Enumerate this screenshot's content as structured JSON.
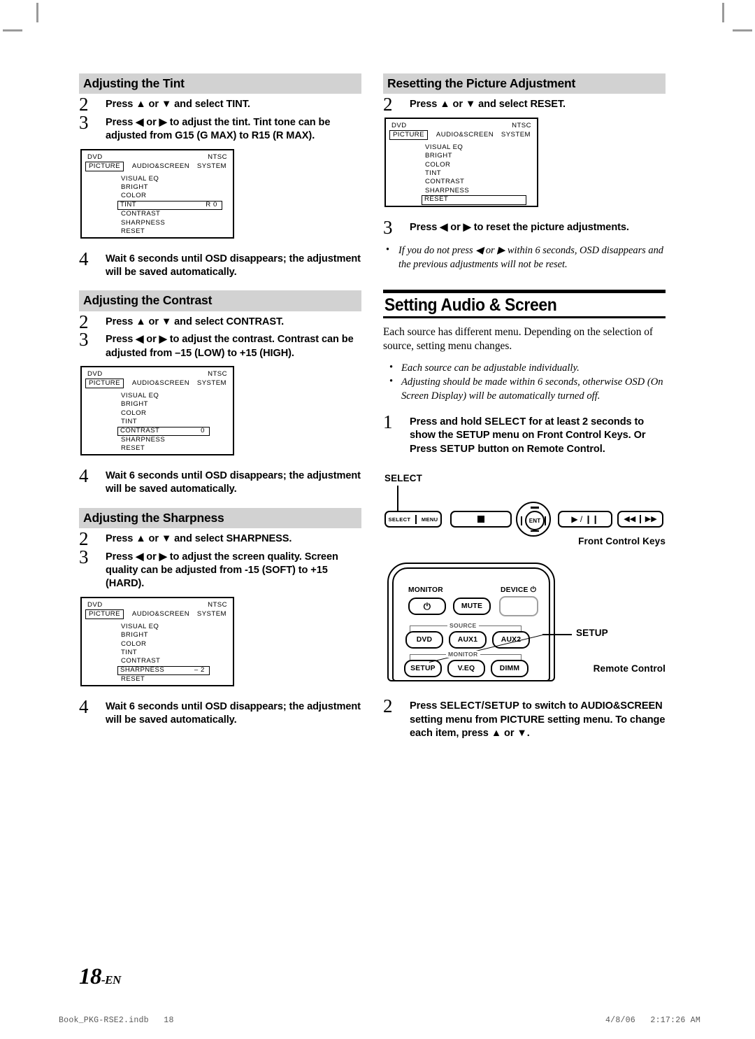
{
  "page": {
    "number_display": "18",
    "number_suffix": "-EN",
    "footer_file": "Book_PKG-RSE2.indb   18",
    "footer_timestamp": "4/8/06   2:17:26 AM"
  },
  "left_column": {
    "sections": [
      {
        "heading": "Adjusting the Tint",
        "steps": [
          {
            "num": "2",
            "text": "Press ▲ or ▼ and select TINT."
          },
          {
            "num": "3",
            "text": "Press ◀ or ▶ to adjust the tint. Tint tone can be adjusted from G15 (G MAX) to R15 (R MAX)."
          }
        ],
        "osd": {
          "source": "DVD",
          "standard": "NTSC",
          "tab_selected": "PICTURE",
          "tab_middle": "AUDIO&SCREEN",
          "tab_right": "SYSTEM",
          "items": [
            {
              "label": "VISUAL EQ",
              "value": "",
              "selected": false
            },
            {
              "label": "BRIGHT",
              "value": "",
              "selected": false
            },
            {
              "label": "COLOR",
              "value": "",
              "selected": false
            },
            {
              "label": "TINT",
              "value": "R   0",
              "selected": true
            },
            {
              "label": "CONTRAST",
              "value": "",
              "selected": false
            },
            {
              "label": "SHARPNESS",
              "value": "",
              "selected": false
            },
            {
              "label": "RESET",
              "value": "",
              "selected": false
            }
          ]
        },
        "after_step": {
          "num": "4",
          "text": "Wait 6 seconds until OSD disappears; the adjustment will be saved automatically."
        }
      },
      {
        "heading": "Adjusting the Contrast",
        "steps": [
          {
            "num": "2",
            "text": "Press ▲ or ▼ and select CONTRAST."
          },
          {
            "num": "3",
            "text": "Press ◀ or ▶ to adjust the contrast. Contrast can be adjusted from –15 (LOW) to +15 (HIGH)."
          }
        ],
        "osd": {
          "source": "DVD",
          "standard": "NTSC",
          "tab_selected": "PICTURE",
          "tab_middle": "AUDIO&SCREEN",
          "tab_right": "SYSTEM",
          "items": [
            {
              "label": "VISUAL EQ",
              "value": "",
              "selected": false
            },
            {
              "label": "BRIGHT",
              "value": "",
              "selected": false
            },
            {
              "label": "COLOR",
              "value": "",
              "selected": false
            },
            {
              "label": "TINT",
              "value": "",
              "selected": false
            },
            {
              "label": "CONTRAST",
              "value": "0",
              "selected": true
            },
            {
              "label": "SHARPNESS",
              "value": "",
              "selected": false
            },
            {
              "label": "RESET",
              "value": "",
              "selected": false
            }
          ]
        },
        "after_step": {
          "num": "4",
          "text": "Wait 6 seconds until OSD disappears; the adjustment will be saved automatically."
        }
      },
      {
        "heading": "Adjusting the Sharpness",
        "steps": [
          {
            "num": "2",
            "text": "Press ▲ or ▼ and select SHARPNESS."
          },
          {
            "num": "3",
            "text": "Press ◀ or ▶ to adjust the screen quality. Screen quality can be adjusted from -15 (SOFT) to +15 (HARD)."
          }
        ],
        "osd": {
          "source": "DVD",
          "standard": "NTSC",
          "tab_selected": "PICTURE",
          "tab_middle": "AUDIO&SCREEN",
          "tab_right": "SYSTEM",
          "items": [
            {
              "label": "VISUAL EQ",
              "value": "",
              "selected": false
            },
            {
              "label": "BRIGHT",
              "value": "",
              "selected": false
            },
            {
              "label": "COLOR",
              "value": "",
              "selected": false
            },
            {
              "label": "TINT",
              "value": "",
              "selected": false
            },
            {
              "label": "CONTRAST",
              "value": "",
              "selected": false
            },
            {
              "label": "SHARPNESS",
              "value": "– 2",
              "selected": true
            },
            {
              "label": "RESET",
              "value": "",
              "selected": false
            }
          ]
        },
        "after_step": {
          "num": "4",
          "text": "Wait 6 seconds until OSD disappears; the adjustment will be saved automatically."
        }
      }
    ]
  },
  "right_column": {
    "reset_section": {
      "heading": "Resetting the Picture Adjustment",
      "step2": {
        "num": "2",
        "text": "Press ▲ or ▼ and select RESET."
      },
      "osd": {
        "source": "DVD",
        "standard": "NTSC",
        "tab_selected": "PICTURE",
        "tab_middle": "AUDIO&SCREEN",
        "tab_right": "SYSTEM",
        "items": [
          {
            "label": "VISUAL EQ",
            "value": "",
            "selected": false
          },
          {
            "label": "BRIGHT",
            "value": "",
            "selected": false
          },
          {
            "label": "COLOR",
            "value": "",
            "selected": false
          },
          {
            "label": "TINT",
            "value": "",
            "selected": false
          },
          {
            "label": "CONTRAST",
            "value": "",
            "selected": false
          },
          {
            "label": "SHARPNESS",
            "value": "",
            "selected": false
          },
          {
            "label": "RESET",
            "value": "",
            "selected": true
          }
        ]
      },
      "step3": {
        "num": "3",
        "text": "Press ◀ or ▶ to reset the picture adjustments."
      },
      "note": "If you do not press ◀ or ▶  within 6 seconds, OSD disappears and the previous adjustments will not be reset."
    },
    "chapter": {
      "title": "Setting Audio & Screen",
      "intro": "Each source has different menu. Depending on the selection of source, setting menu changes.",
      "notes": [
        "Each source can be adjustable individually.",
        "Adjusting should be made within 6 seconds, otherwise OSD (On Screen Display) will be automatically turned off."
      ],
      "step1": {
        "num": "1",
        "segments": [
          {
            "t": "Press and hold ",
            "bold": false
          },
          {
            "t": "SELECT",
            "bold": true
          },
          {
            "t": " for at least 2 seconds to show the SETUP menu on Front Control Keys. Or Press ",
            "bold": false
          },
          {
            "t": "SETUP",
            "bold": true
          },
          {
            "t": " button on Remote Control.",
            "bold": false
          }
        ]
      },
      "step2": {
        "num": "2",
        "segments": [
          {
            "t": "Press ",
            "bold": false
          },
          {
            "t": "SELECT/SETUP",
            "bold": true
          },
          {
            "t": " to switch to AUDIO&SCREEN setting menu from PICTURE setting menu. To change each item, press ▲ or ▼.",
            "bold": false
          }
        ]
      }
    },
    "front_control_keys": {
      "callout_label": "SELECT",
      "caption": "Front Control Keys",
      "keys": [
        {
          "name": "select-menu-key",
          "labels": [
            "SELECT",
            "MENU"
          ]
        },
        {
          "name": "stop-key",
          "glyph": "stop"
        },
        {
          "name": "ent-key",
          "label": "ENT"
        },
        {
          "name": "play-pause-key",
          "glyph": "▶ / ❙❙"
        },
        {
          "name": "skip-key",
          "glyphs": [
            "◀◀",
            "▶▶"
          ]
        }
      ]
    },
    "remote_control": {
      "callout_label": "SETUP",
      "caption": "Remote Control",
      "labels": {
        "monitor_top": "MONITOR",
        "device": "DEVICE",
        "source_group": "SOURCE",
        "monitor_group": "MONITOR"
      },
      "buttons": [
        {
          "name": "power-button",
          "label": "⏻"
        },
        {
          "name": "mute-button",
          "label": "MUTE"
        },
        {
          "name": "device-power-button",
          "label": ""
        },
        {
          "name": "dvd-button",
          "label": "DVD"
        },
        {
          "name": "aux1-button",
          "label": "AUX1"
        },
        {
          "name": "aux2-button",
          "label": "AUX2"
        },
        {
          "name": "setup-button",
          "label": "SETUP"
        },
        {
          "name": "veq-button",
          "label": "V.EQ"
        },
        {
          "name": "dimm-button",
          "label": "DIMM"
        }
      ]
    }
  }
}
